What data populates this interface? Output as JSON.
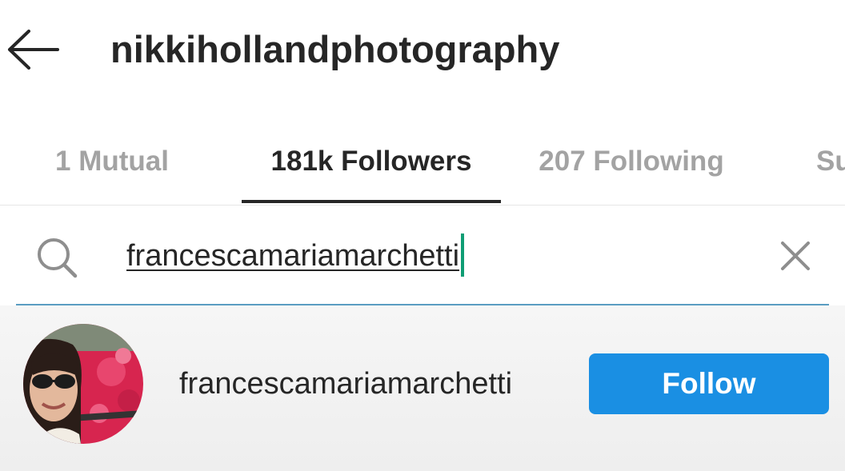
{
  "header": {
    "back_icon": "arrow-left-icon",
    "title": "nikkihollandphotography"
  },
  "tabs": [
    {
      "label": "1 Mutual",
      "active": false
    },
    {
      "label": "181k Followers",
      "active": true
    },
    {
      "label": "207 Following",
      "active": false
    },
    {
      "label": "Su",
      "active": false
    }
  ],
  "search": {
    "icon": "search-icon",
    "value": "francescamariamarchetti",
    "clear_icon": "close-icon"
  },
  "results": [
    {
      "username": "francescamariamarchetti",
      "follow_label": "Follow"
    }
  ],
  "colors": {
    "accent": "#1a8fe3",
    "search_underline": "#5a9dc2",
    "caret": "#0f9d74",
    "inactive_tab": "#a3a3a3"
  }
}
